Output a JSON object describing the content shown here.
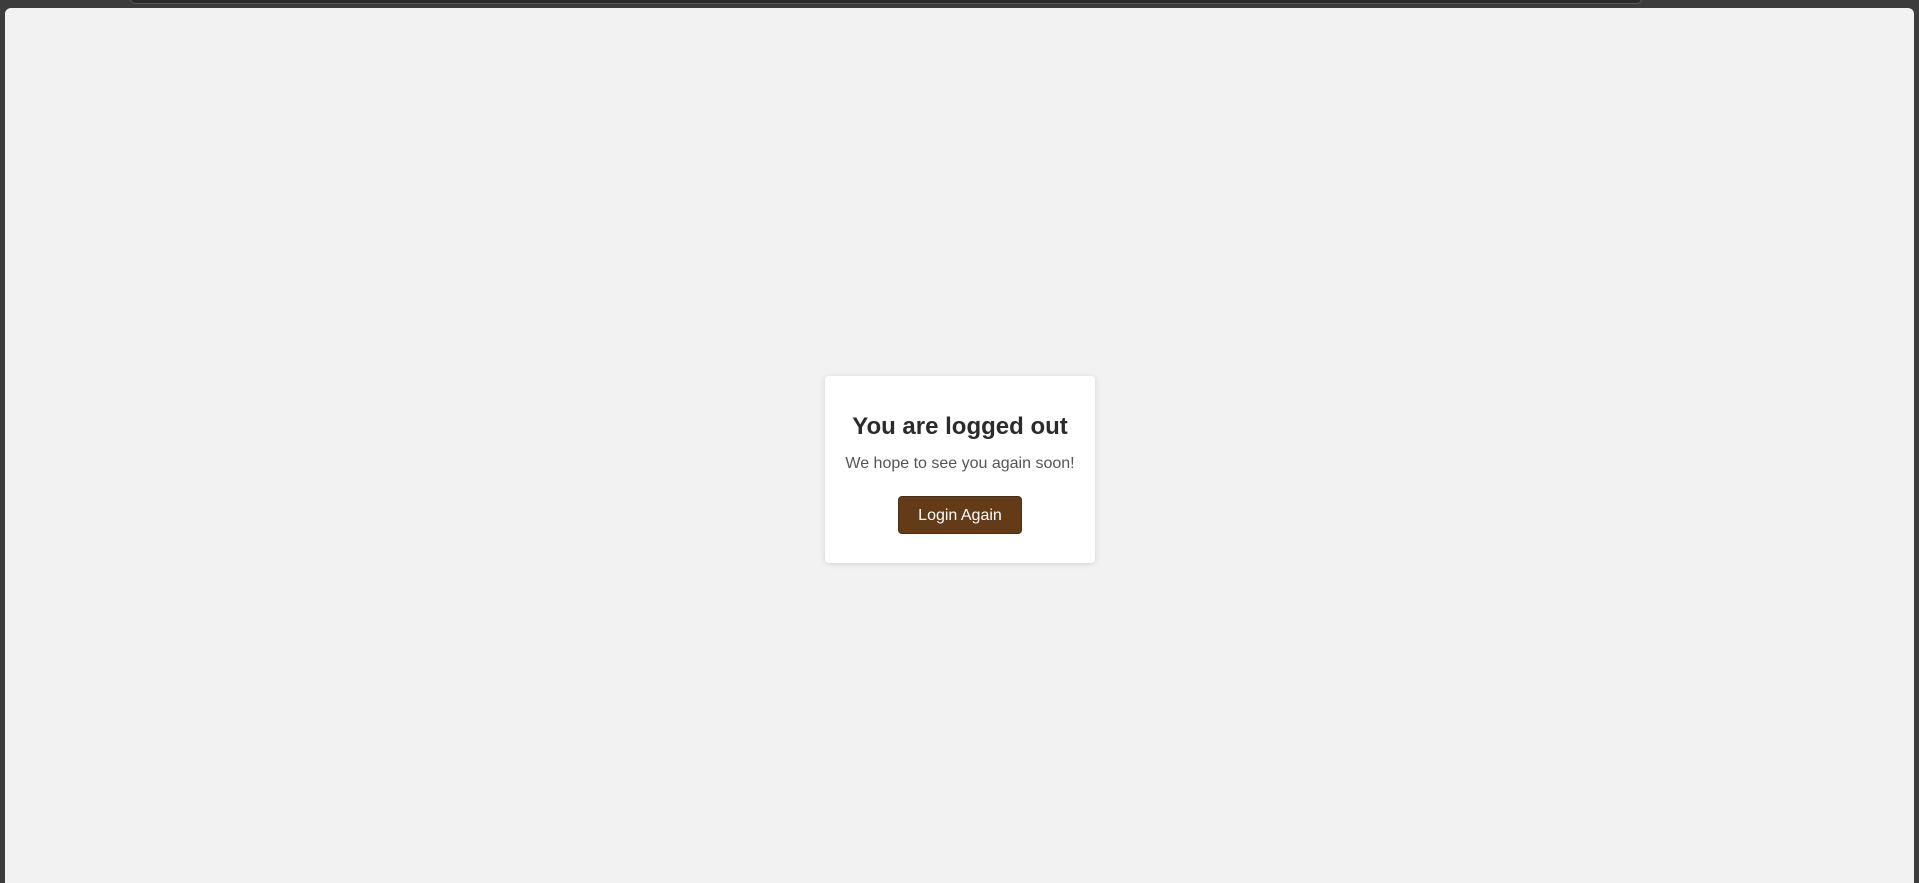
{
  "logout_card": {
    "title": "You are logged out",
    "message": "We hope to see you again soon!",
    "button_label": "Login Again"
  },
  "colors": {
    "page_background": "#f2f2f2",
    "card_background": "#ffffff",
    "button_background": "#633c17",
    "button_text": "#ffffff",
    "title_text": "#2b2b2b",
    "message_text": "#555555"
  }
}
